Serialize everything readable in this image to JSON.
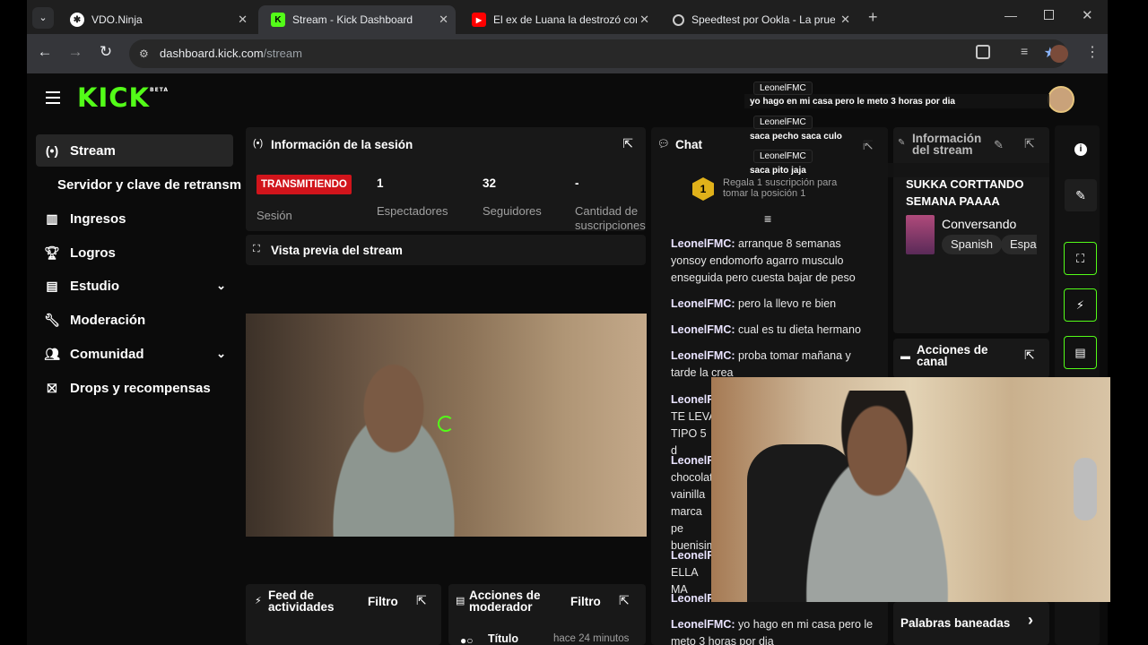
{
  "browser": {
    "tabs": [
      {
        "title": "VDO.Ninja",
        "active": false
      },
      {
        "title": "Stream - Kick Dashboard",
        "active": true
      },
      {
        "title": "El ex de Luana la destrozó con t",
        "active": false
      },
      {
        "title": "Speedtest por Ookla - La prueb",
        "active": false
      }
    ],
    "url_host": "dashboard.kick.com",
    "url_path": "/stream"
  },
  "brand": {
    "logo": "KICK",
    "beta": "BETA",
    "accent": "#53fc18"
  },
  "sidebar": {
    "items": [
      {
        "label": "Stream",
        "icon": "broadcast-icon"
      },
      {
        "label": "Servidor y clave de retransm",
        "icon": ""
      },
      {
        "label": "Ingresos",
        "icon": "chart-icon"
      },
      {
        "label": "Logros",
        "icon": "trophy-icon"
      },
      {
        "label": "Estudio",
        "icon": "studio-icon"
      },
      {
        "label": "Moderación",
        "icon": "wrench-icon"
      },
      {
        "label": "Comunidad",
        "icon": "community-icon"
      },
      {
        "label": "Drops y recompensas",
        "icon": "gift-icon"
      }
    ]
  },
  "session": {
    "title": "Información de la sesión",
    "status": "TRANSMITIENDO",
    "status_label": "Sesión",
    "viewers": "1",
    "viewers_label": "Espectadores",
    "followers": "32",
    "followers_label": "Seguidores",
    "subs": "-",
    "subs_label": "Cantidad de suscripciones"
  },
  "preview": {
    "title": "Vista previa del stream"
  },
  "activity": {
    "title": "Feed de actividades",
    "filter": "Filtro"
  },
  "modactions": {
    "title": "Acciones de moderador",
    "filter": "Filtro",
    "row_title": "Título",
    "row_time": "hace 24 minutos"
  },
  "chat": {
    "title": "Chat",
    "gift_text": "Regala 1 suscripción para tomar la posición 1",
    "gift_rank": "1",
    "messages": [
      {
        "user": "LeonelFMC:",
        "text": "arranque 8 semanas yonsoy endomorfo agarro musculo enseguida pero cuesta bajar de peso"
      },
      {
        "user": "LeonelFMC:",
        "text": "pero la llevo re bien"
      },
      {
        "user": "LeonelFMC:",
        "text": "cual es tu dieta hermano"
      },
      {
        "user": "LeonelFMC:",
        "text": "proba tomar mañana y tarde la crea"
      },
      {
        "user": "LeonelFMC:",
        "text": "TE LEVA TIPO 5 d"
      },
      {
        "user": "LeonelFMC:",
        "text": "chocolat vainilla marca pe buenisim"
      },
      {
        "user": "LeonelFMC:",
        "text": "ELLA MA"
      },
      {
        "user": "LeonelFMC",
        "text": ""
      },
      {
        "user": "LeonelFMC:",
        "text": "yo hago en mi casa pero le meto 3 horas por dia"
      }
    ]
  },
  "stream_info": {
    "title": "Información del stream",
    "stream_title": "SUKKA CORTTANDO SEMANA PAAAA",
    "category": "Conversando",
    "tags": [
      "Spanish",
      "Espa"
    ]
  },
  "channel_actions": {
    "title": "Acciones de canal"
  },
  "banned_words": {
    "label": "Palabras baneadas"
  },
  "overlay": [
    {
      "user": "LeonelFMC",
      "text": "yo hago en mi casa pero le meto 3 horas por dia"
    },
    {
      "user": "LeonelFMC",
      "text": "saca pecho saca culo"
    },
    {
      "user": "LeonelFMC",
      "text": "saca pito jaja"
    }
  ]
}
